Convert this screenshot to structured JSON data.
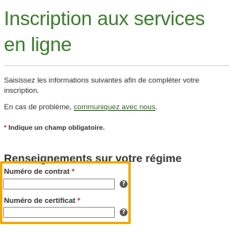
{
  "page": {
    "title": "Inscription aux services en ligne",
    "intro": "Saisissez les informations suivantes afin de compléter votre inscription.",
    "help_prefix": "En cas de problème, ",
    "help_link": "communiquez avec nous",
    "help_suffix": ".",
    "required_star": "*",
    "required_text": " Indique un champ obligatoire."
  },
  "section": {
    "title": "Renseignements sur votre régime"
  },
  "form": {
    "contract": {
      "label": "Numéro de contrat",
      "star": "*",
      "value": "",
      "help_icon": "question-circle-icon"
    },
    "certificate": {
      "label": "Numéro de certificat",
      "star": "*",
      "value": "",
      "help_icon": "question-circle-icon"
    }
  },
  "colors": {
    "title": "#3a7d2c",
    "link": "#2e6b1f",
    "required_star": "#c62828",
    "highlight": "#f2a900"
  }
}
